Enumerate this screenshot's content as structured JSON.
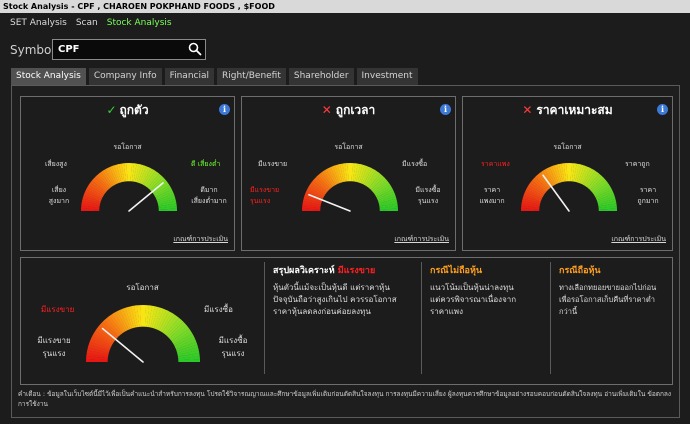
{
  "window": {
    "title": "Stock Analysis - CPF , CHAROEN POKPHAND FOODS , $FOOD"
  },
  "nav": {
    "items": [
      "SET Analysis",
      "Scan",
      "Stock Analysis"
    ]
  },
  "symbol": {
    "label": "Symbol",
    "value": "CPF"
  },
  "tabs": [
    "Stock Analysis",
    "Company Info",
    "Financial",
    "Right/Benefit",
    "Shareholder",
    "Investment"
  ],
  "cards": [
    {
      "mark": "✓",
      "title": "ถูกตัว",
      "top": "รอโอกาส",
      "left_upper": "เสี่ยงสูง",
      "right_upper": "ดี เสี่ยงต่ำ",
      "left_lower": [
        "เสี่ยง",
        "สูงมาก"
      ],
      "right_lower": [
        "ดีมาก",
        "เสี่ยงต่ำมาก"
      ],
      "needle_value": 0.78,
      "link": "เกณฑ์การประเมิน"
    },
    {
      "mark": "✕",
      "title": "ถูกเวลา",
      "top": "รอโอกาส",
      "left_upper": "มีแรงขาย",
      "right_upper": "มีแรงซื้อ",
      "left_lower": [
        "มีแรงขาย",
        "รุนแรง"
      ],
      "right_lower": [
        "มีแรงซื้อ",
        "รุนแรง"
      ],
      "needle_value": 0.12,
      "link": "เกณฑ์การประเมิน"
    },
    {
      "mark": "✕",
      "title": "ราคาเหมาะสม",
      "top": "รอโอกาส",
      "left_upper": "ราคาแพง",
      "right_upper": "ราคาถูก",
      "left_lower": [
        "ราคา",
        "แพงมาก"
      ],
      "right_lower": [
        "ราคา",
        "ถูกมาก"
      ],
      "needle_value": 0.3,
      "link": "เกณฑ์การประเมิน"
    }
  ],
  "summary": {
    "gauge": {
      "top": "รอโอกาส",
      "left_upper": "มีแรงขาย",
      "right_upper": "มีแรงซื้อ",
      "left_lower": [
        "มีแรงขาย",
        "รุนแรง"
      ],
      "right_lower": [
        "มีแรงซื้อ",
        "รุนแรง"
      ],
      "needle_value": 0.22
    },
    "conclusion": {
      "heading": "สรุปผลวิเคราะห์",
      "status": "มีแรงขาย",
      "lines": [
        "หุ้นตัวนี้แม้จะเป็นหุ้นดี แต่ราคาหุ้น",
        "ปัจจุบันถือว่าสูงเกินไป ควรรอโอกาส",
        "ราคาหุ้นลดลงก่อนค่อยลงทุน"
      ]
    },
    "not_holding": {
      "heading": "กรณีไม่ถือหุ้น",
      "lines": [
        "แนวโน้มเป็นหุ้นน่าลงทุน",
        "แต่ควรพิจารณาเนื่องจาก",
        "ราคาแพง"
      ]
    },
    "holding": {
      "heading": "กรณีถือหุ้น",
      "lines": [
        "ทางเลือกทยอยขายออกไปก่อน",
        "เพื่อรอโอกาสเก็บคืนที่ราคาต่ำ",
        "กว่านี้"
      ]
    }
  },
  "disclaimer": "คำเตือน : ข้อมูลในเว็บไซต์นี้มีไว้เพื่อเป็นคำแนะนำสำหรับการลงทุน โปรดใช้วิจารณญาณและศึกษาข้อมูลเพิ่มเติมก่อนตัดสินใจลงทุน การลงทุนมีความเสี่ยง ผู้ลงทุนควรศึกษาข้อมูลอย่างรอบคอบก่อนตัดสินใจลงทุน อ่านเพิ่มเติมใน ข้อตกลงการใช้งาน",
  "colors": {
    "active_green": "#7bff5a",
    "danger": "#ff2020",
    "accent_orange": "#ffa020",
    "info_blue": "#3d79d6"
  }
}
